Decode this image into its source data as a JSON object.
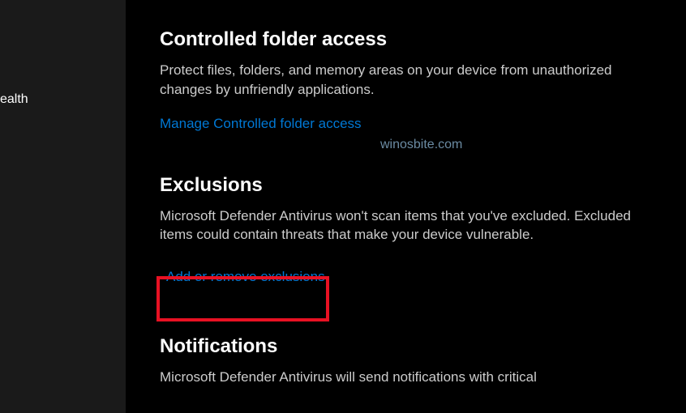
{
  "sidebar": {
    "item_label": "ealth"
  },
  "sections": {
    "controlled_folder": {
      "title": "Controlled folder access",
      "desc": "Protect files, folders, and memory areas on your device from unauthorized changes by unfriendly applications.",
      "link": "Manage Controlled folder access"
    },
    "exclusions": {
      "title": "Exclusions",
      "desc": "Microsoft Defender Antivirus won't scan items that you've excluded. Excluded items could contain threats that make your device vulnerable.",
      "link": "Add or remove exclusions"
    },
    "notifications": {
      "title": "Notifications",
      "desc": "Microsoft Defender Antivirus will send notifications with critical"
    }
  },
  "watermark": "winosbite.com"
}
